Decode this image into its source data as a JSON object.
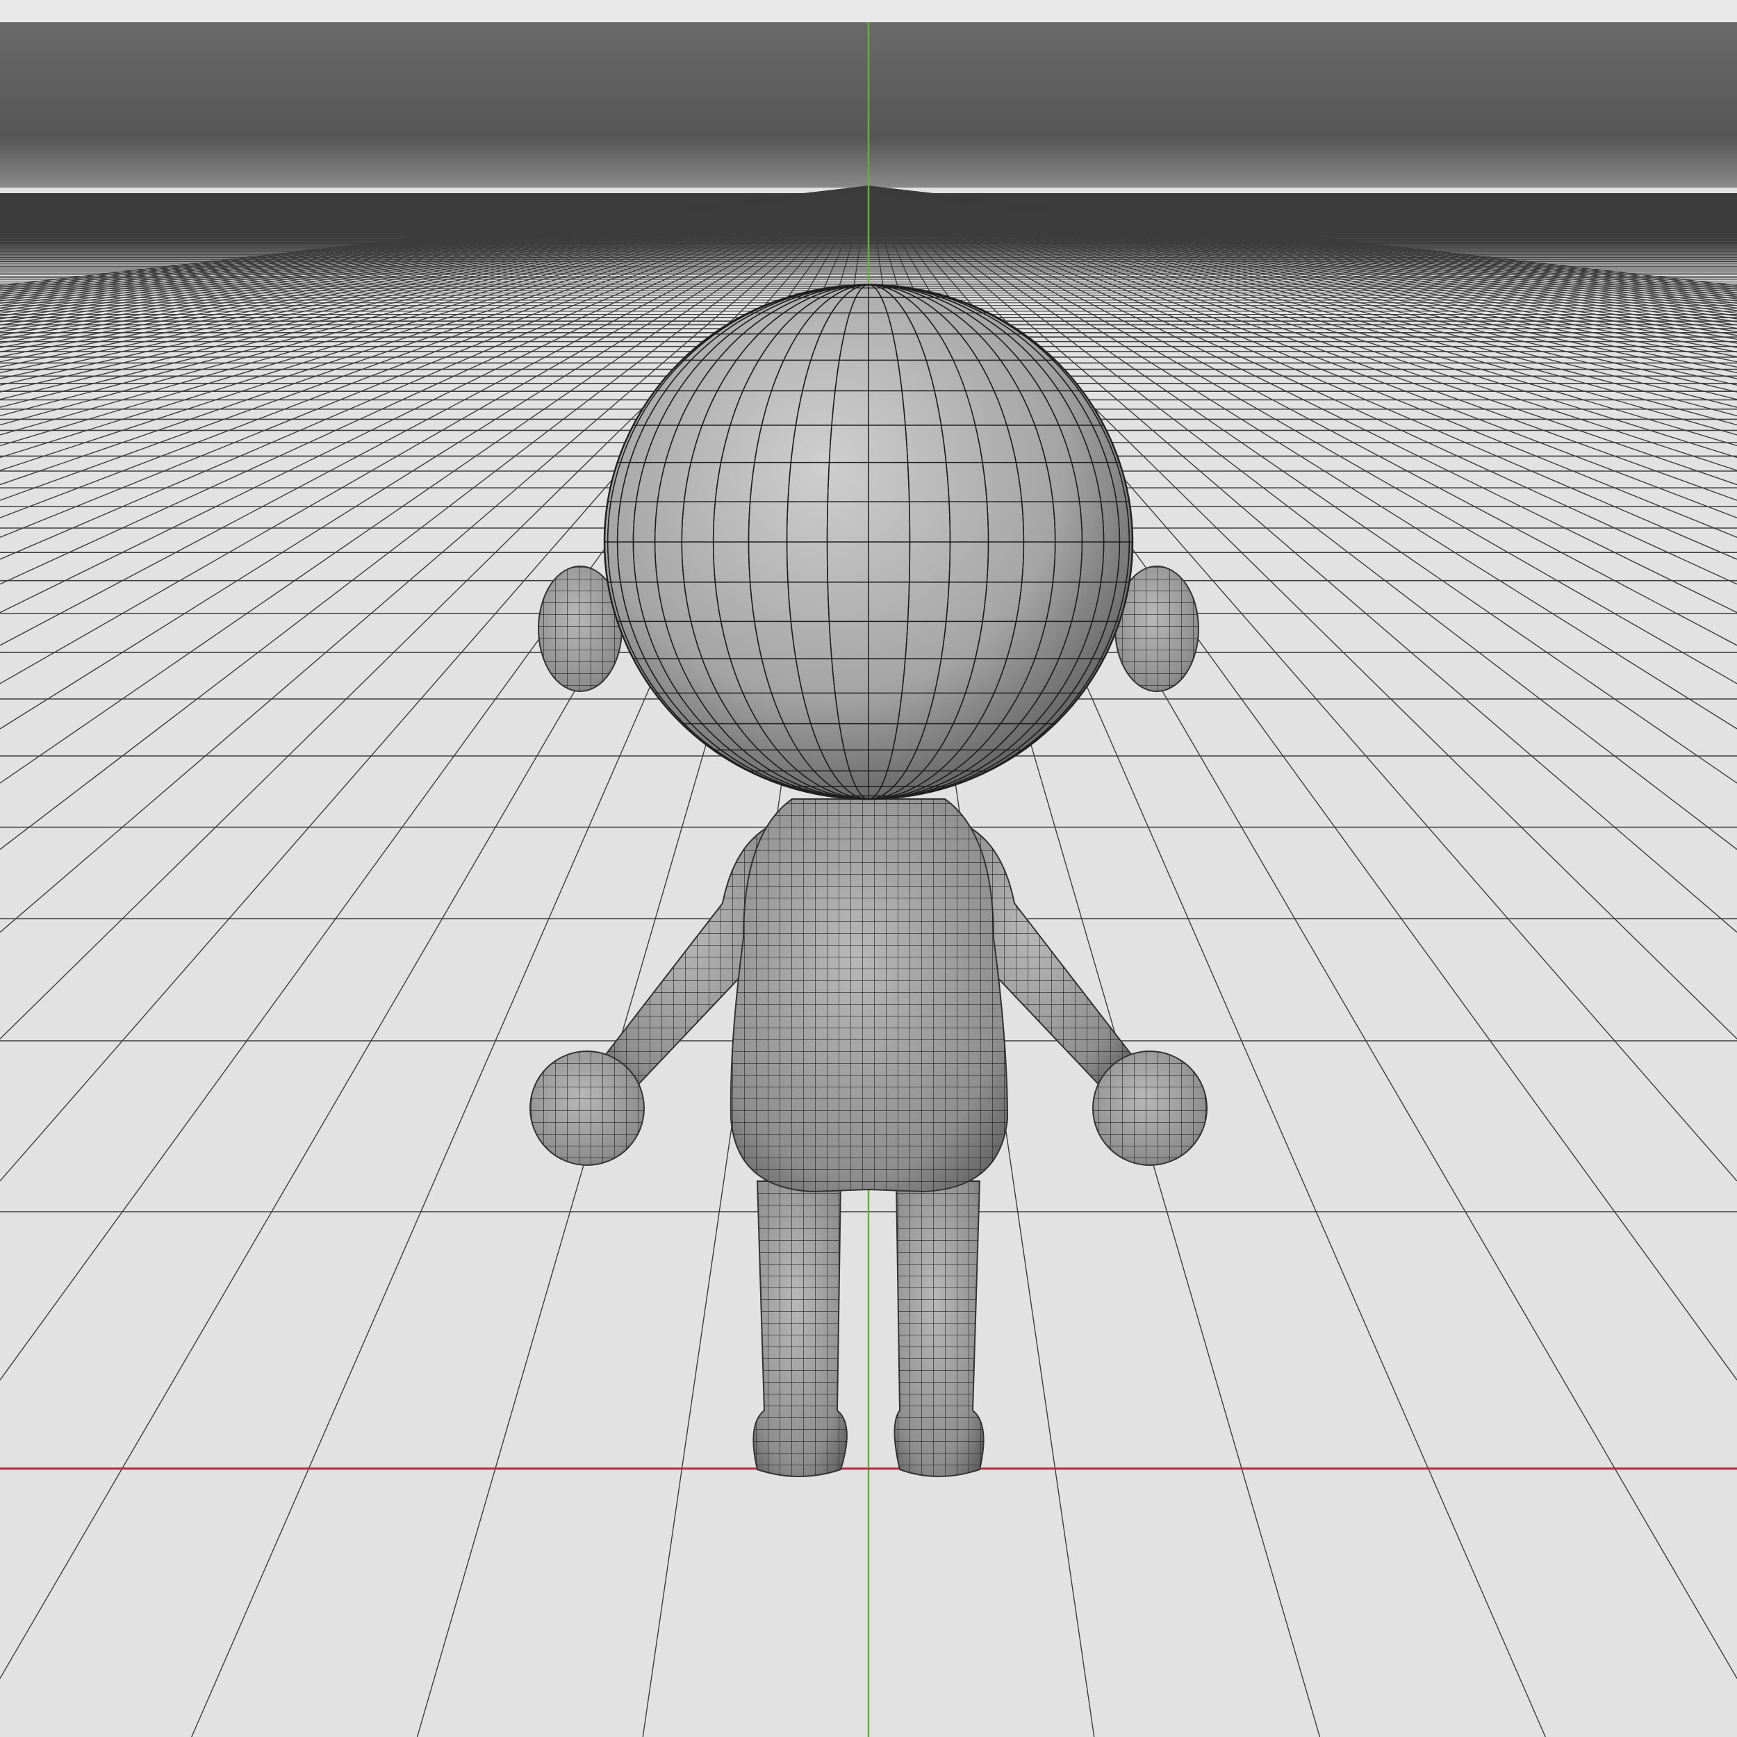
{
  "viewport": {
    "colors": {
      "floor": "#e2e2e2",
      "grid_line": "#3c3c3c",
      "sky_band": "#5a5a5a",
      "top_strip": "#e8e8e8",
      "axis_x": "#c0283a",
      "axis_y": "#6aa84f",
      "mesh_light": "#c4c4c4",
      "mesh_dark": "#5e5e5e",
      "wire": "#1e1e1e"
    }
  }
}
